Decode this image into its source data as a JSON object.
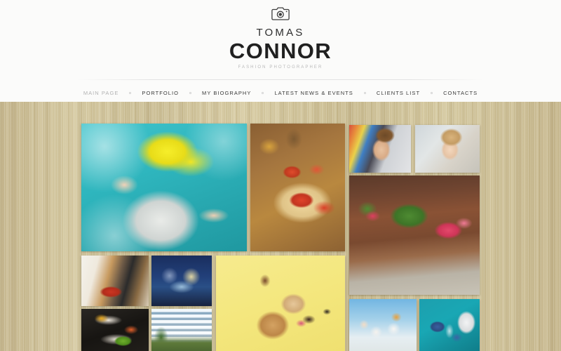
{
  "site": {
    "brand_line1": "TOMAS",
    "brand_line2": "CONNOR",
    "tagline": "FASHION PHOTOGRAPHER",
    "logo_icon": "camera-icon",
    "accent_color": "#2d2d2d",
    "background_color": "#cfc293",
    "header_background": "#fbfbfa"
  },
  "nav": {
    "items": [
      {
        "label": "MAIN PAGE",
        "active": true
      },
      {
        "label": "PORTFOLIO",
        "active": false
      },
      {
        "label": "MY BIOGRAPHY",
        "active": false
      },
      {
        "label": "LATEST NEWS & EVENTS",
        "active": false
      },
      {
        "label": "CLIENTS LIST",
        "active": false
      },
      {
        "label": "CONTACTS",
        "active": false
      }
    ],
    "separator_icon": "dot-separator-icon"
  },
  "gallery": {
    "tiles": [
      {
        "id": "model",
        "alt": "Fashion model with yellow curly hair on teal background"
      },
      {
        "id": "food",
        "alt": "Bruschetta with tomatoes on wooden board"
      },
      {
        "id": "man",
        "alt": "Young man portrait with styled hair"
      },
      {
        "id": "child",
        "alt": "Curly haired child portrait"
      },
      {
        "id": "garden",
        "alt": "Wooden planters with red flowers and greenery"
      },
      {
        "id": "interior",
        "alt": "Modern living room interior with red rug"
      },
      {
        "id": "night",
        "alt": "Illuminated fountain at night"
      },
      {
        "id": "spoons",
        "alt": "Spoons with colorful spices on black background"
      },
      {
        "id": "building",
        "alt": "Modern white apartment building"
      },
      {
        "id": "dog",
        "alt": "Dog portrait on yellow background"
      },
      {
        "id": "family",
        "alt": "Family with children outdoors under blue sky"
      },
      {
        "id": "lab",
        "alt": "Scientists in protective suits working in laboratory"
      }
    ]
  }
}
